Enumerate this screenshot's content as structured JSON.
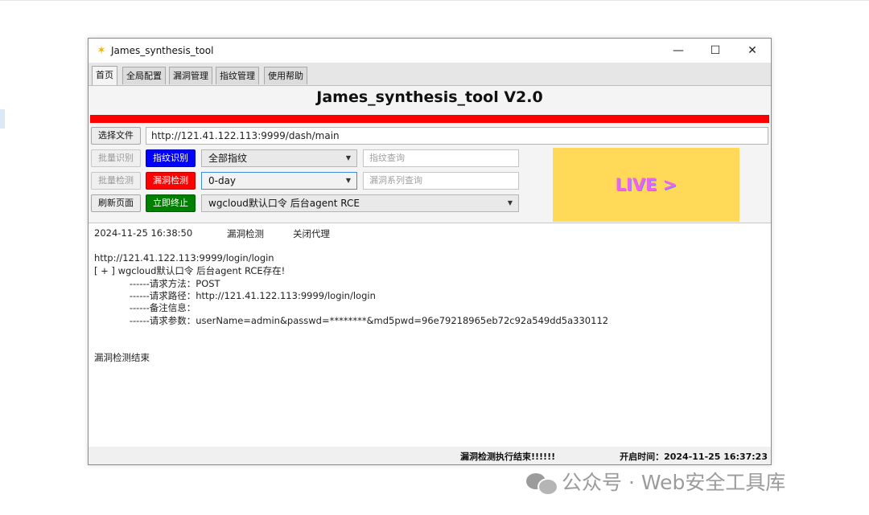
{
  "window": {
    "title": "James_synthesis_tool",
    "minimize_glyph": "—",
    "maximize_glyph": "☐",
    "close_glyph": "✕"
  },
  "tabs": [
    {
      "label": "首页",
      "active": true
    },
    {
      "label": "全局配置",
      "active": false
    },
    {
      "label": "漏洞管理",
      "active": false
    },
    {
      "label": "指纹管理",
      "active": false
    },
    {
      "label": "使用帮助",
      "active": false
    }
  ],
  "heading": "James_synthesis_tool V2.0",
  "toolbar": {
    "select_file_label": "选择文件",
    "url_value": "http://121.41.122.113:9999/dash/main",
    "batch_identify_label": "批量识别",
    "fingerprint_identify_label": "指纹识别",
    "fingerprint_combo_value": "全部指纹",
    "fingerprint_search_placeholder": "指纹查询",
    "batch_detect_label": "批量检测",
    "vuln_detect_label": "漏洞检测",
    "vuln_combo_value": "0-day",
    "vuln_search_placeholder": "漏洞系列查询",
    "refresh_label": "刷新页面",
    "stop_label": "立即终止",
    "poc_combo_value": "wgcloud默认口令 后台agent RCE"
  },
  "banner": {
    "text": "LIVE >",
    "color": "#ffd957"
  },
  "log": {
    "time": "2024-11-25 16:38:50",
    "action": "漏洞检测",
    "proxy": "关闭代理",
    "lines": [
      "http://121.41.122.113:9999/login/login",
      "[ + ] wgcloud默认口令 后台agent RCE存在!",
      "            ------请求方法：POST",
      "            ------请求路径：http://121.41.122.113:9999/login/login",
      "            ------备注信息：",
      "            ------请求参数：userName=admin&passwd=********&md5pwd=96e79218965eb72c92a549dd5a330112"
    ],
    "end_text": "漏洞检测结束"
  },
  "status": {
    "message": "漏洞检测执行结束!!!!!!",
    "start_time": "开启时间：2024-11-25 16:37:23"
  },
  "watermark": {
    "text": "公众号 · Web安全工具库"
  },
  "colors": {
    "accent_red": "#ff0000",
    "identify_blue": "#0000ff",
    "stop_green": "#008000"
  }
}
